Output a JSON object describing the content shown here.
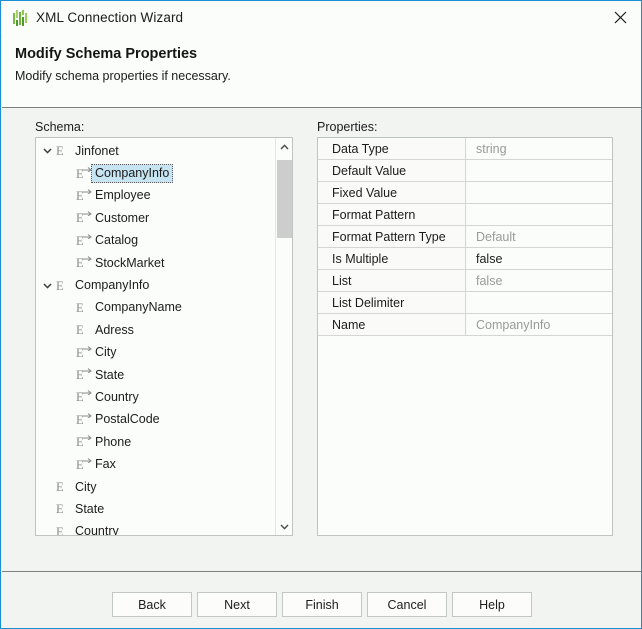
{
  "window": {
    "title": "XML Connection Wizard",
    "icon": "bar-chart-icon",
    "close_label": "close-icon"
  },
  "header": {
    "title": "Modify Schema Properties",
    "subtitle": "Modify schema properties if necessary."
  },
  "schema": {
    "label": "Schema:",
    "nodes": [
      {
        "label": "Jinfonet",
        "level": 0,
        "expanded": true,
        "kind": "element",
        "selected": false
      },
      {
        "label": "CompanyInfo",
        "level": 1,
        "expanded": null,
        "kind": "reference",
        "selected": true
      },
      {
        "label": "Employee",
        "level": 1,
        "expanded": null,
        "kind": "reference",
        "selected": false
      },
      {
        "label": "Customer",
        "level": 1,
        "expanded": null,
        "kind": "reference",
        "selected": false
      },
      {
        "label": "Catalog",
        "level": 1,
        "expanded": null,
        "kind": "reference",
        "selected": false
      },
      {
        "label": "StockMarket",
        "level": 1,
        "expanded": null,
        "kind": "reference",
        "selected": false
      },
      {
        "label": "CompanyInfo",
        "level": 0,
        "expanded": true,
        "kind": "element",
        "selected": false
      },
      {
        "label": "CompanyName",
        "level": 1,
        "expanded": null,
        "kind": "element",
        "selected": false
      },
      {
        "label": "Adress",
        "level": 1,
        "expanded": null,
        "kind": "element",
        "selected": false
      },
      {
        "label": "City",
        "level": 1,
        "expanded": null,
        "kind": "reference",
        "selected": false
      },
      {
        "label": "State",
        "level": 1,
        "expanded": null,
        "kind": "reference",
        "selected": false
      },
      {
        "label": "Country",
        "level": 1,
        "expanded": null,
        "kind": "reference",
        "selected": false
      },
      {
        "label": "PostalCode",
        "level": 1,
        "expanded": null,
        "kind": "reference",
        "selected": false
      },
      {
        "label": "Phone",
        "level": 1,
        "expanded": null,
        "kind": "reference",
        "selected": false
      },
      {
        "label": "Fax",
        "level": 1,
        "expanded": null,
        "kind": "reference",
        "selected": false
      },
      {
        "label": "City",
        "level": 0,
        "expanded": null,
        "kind": "element",
        "selected": false
      },
      {
        "label": "State",
        "level": 0,
        "expanded": null,
        "kind": "element",
        "selected": false
      },
      {
        "label": "Country",
        "level": 0,
        "expanded": null,
        "kind": "element",
        "selected": false
      }
    ],
    "scrollbar": {
      "up_arrow": "chevron-up-icon",
      "down_arrow": "chevron-down-icon"
    }
  },
  "properties": {
    "label": "Properties:",
    "rows": [
      {
        "name": "Data Type",
        "value": "string",
        "emphasis": false
      },
      {
        "name": "Default Value",
        "value": "",
        "emphasis": false
      },
      {
        "name": "Fixed Value",
        "value": "",
        "emphasis": false
      },
      {
        "name": "Format Pattern",
        "value": "",
        "emphasis": false
      },
      {
        "name": "Format Pattern Type",
        "value": "Default",
        "emphasis": false
      },
      {
        "name": "Is Multiple",
        "value": "false",
        "emphasis": true
      },
      {
        "name": "List",
        "value": "false",
        "emphasis": false
      },
      {
        "name": "List Delimiter",
        "value": "",
        "emphasis": false
      },
      {
        "name": "Name",
        "value": "CompanyInfo",
        "emphasis": false
      }
    ]
  },
  "footer": {
    "buttons": [
      {
        "label": "Back"
      },
      {
        "label": "Next"
      },
      {
        "label": "Finish"
      },
      {
        "label": "Cancel"
      },
      {
        "label": "Help"
      }
    ]
  },
  "colors": {
    "accent_border": "#1b8fd4",
    "selection": "#c6e4f2",
    "icon_green": "#78bb3f",
    "muted_text": "#9a9a9a"
  }
}
